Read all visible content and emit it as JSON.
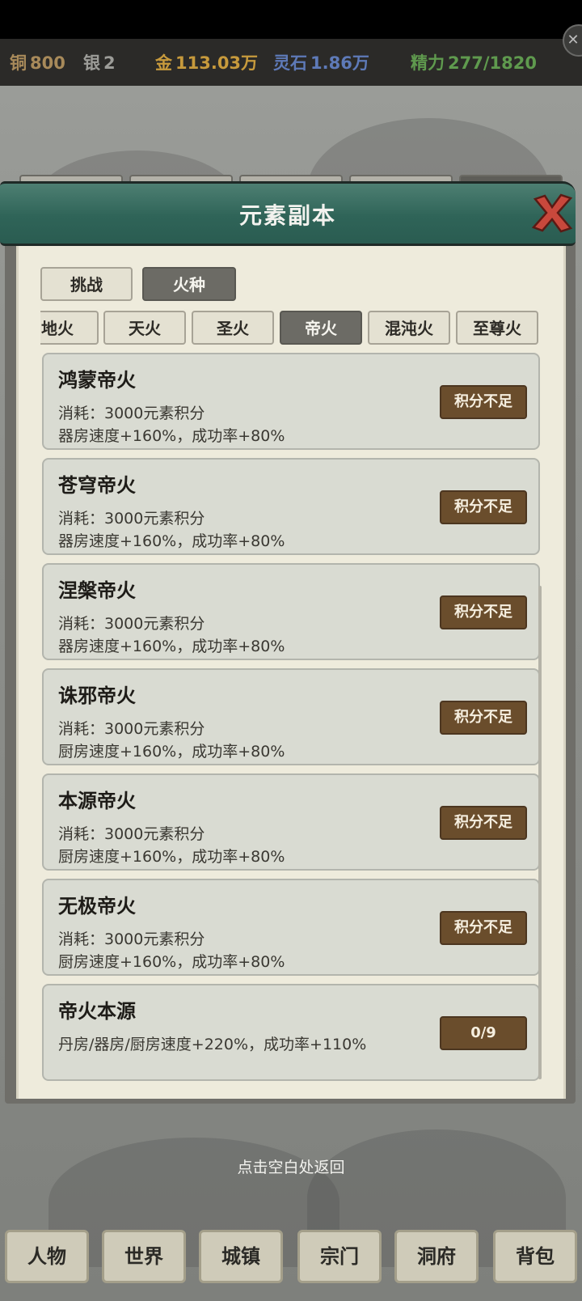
{
  "resources": {
    "copper": {
      "label": "铜",
      "value": "800"
    },
    "silver": {
      "label": "银",
      "value": "2"
    },
    "gold": {
      "label": "金",
      "value": "113.03万"
    },
    "spirit_stone": {
      "label": "灵石",
      "value": "1.86万"
    },
    "energy": {
      "label": "精力",
      "value": "277/1820"
    }
  },
  "dialog": {
    "title": "元素副本",
    "mode_tabs": [
      {
        "label": "挑战",
        "active": false
      },
      {
        "label": "火种",
        "active": true
      }
    ],
    "fire_tabs": [
      {
        "label": "地火",
        "active": false
      },
      {
        "label": "天火",
        "active": false
      },
      {
        "label": "圣火",
        "active": false
      },
      {
        "label": "帝火",
        "active": true
      },
      {
        "label": "混沌火",
        "active": false
      },
      {
        "label": "至尊火",
        "active": false
      }
    ],
    "items": [
      {
        "name": "鸿蒙帝火",
        "cost": "消耗：3000元素积分",
        "effect": "器房速度+160%，成功率+80%",
        "button": "积分不足"
      },
      {
        "name": "苍穹帝火",
        "cost": "消耗：3000元素积分",
        "effect": "器房速度+160%，成功率+80%",
        "button": "积分不足"
      },
      {
        "name": "涅槃帝火",
        "cost": "消耗：3000元素积分",
        "effect": "器房速度+160%，成功率+80%",
        "button": "积分不足"
      },
      {
        "name": "诛邪帝火",
        "cost": "消耗：3000元素积分",
        "effect": "厨房速度+160%，成功率+80%",
        "button": "积分不足"
      },
      {
        "name": "本源帝火",
        "cost": "消耗：3000元素积分",
        "effect": "厨房速度+160%，成功率+80%",
        "button": "积分不足"
      },
      {
        "name": "无极帝火",
        "cost": "消耗：3000元素积分",
        "effect": "厨房速度+160%，成功率+80%",
        "button": "积分不足"
      },
      {
        "name": "帝火本源",
        "cost": "丹房/器房/厨房速度+220%，成功率+110%",
        "effect": "",
        "button": "0/9"
      }
    ],
    "hint": "点击空白处返回"
  },
  "bottom_nav": [
    "人物",
    "世界",
    "城镇",
    "宗门",
    "洞府",
    "背包"
  ],
  "colors": {
    "header_teal": "#2f6458",
    "card_button_brown": "#6a4d2c",
    "gold_text": "#c79a3c",
    "stone_text": "#5e7ab8",
    "energy_text": "#5f9a4e"
  }
}
